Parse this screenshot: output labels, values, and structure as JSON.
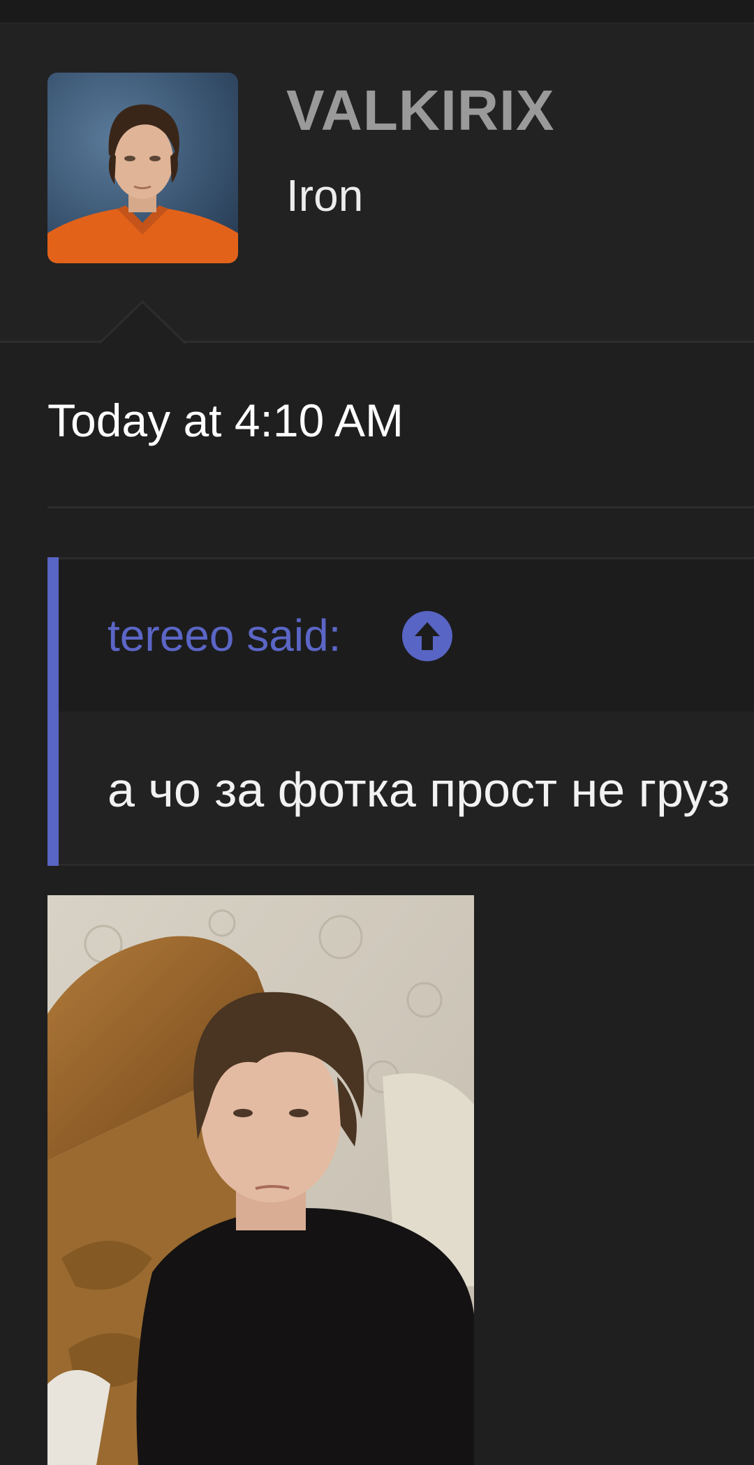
{
  "post": {
    "username": "VALKIRIX",
    "user_title": "Iron",
    "date": "Today at 4:10 AM"
  },
  "quote": {
    "author_line": "tereeo said:",
    "text": "а чо за фотка прост не груз",
    "up_icon": "arrow-up-circle-icon"
  },
  "colors": {
    "background": "#1f1f20",
    "username": "#9a9a9a",
    "quote_accent": "#5865c4",
    "quote_author": "#5b66c6"
  }
}
